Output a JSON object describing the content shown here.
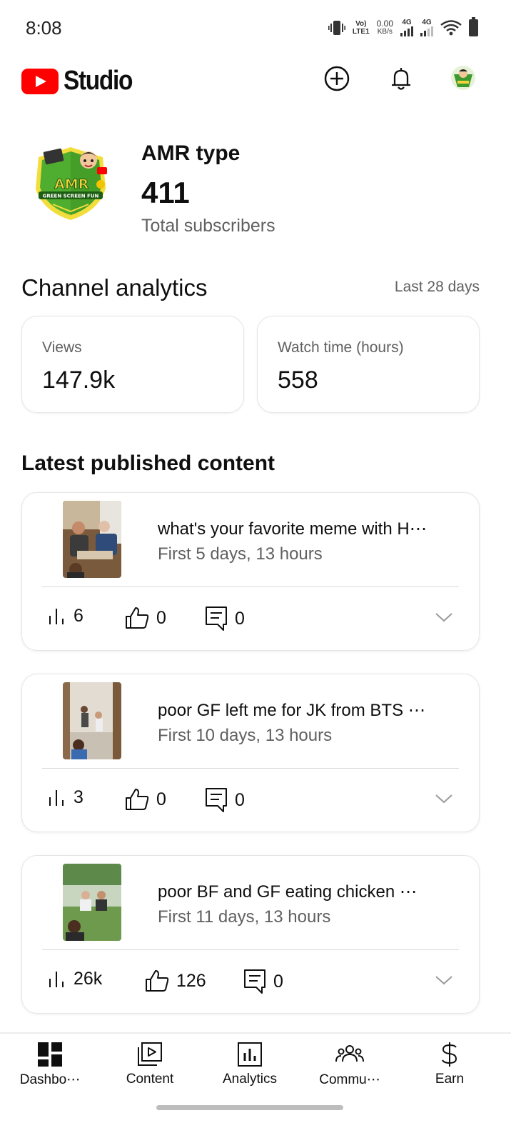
{
  "status_bar": {
    "time": "8:08",
    "volte": "Vo)",
    "lte": "LTE1",
    "speed_value": "0.00",
    "speed_unit": "KB/s",
    "net1": "4G",
    "net2": "4G"
  },
  "header": {
    "brand": "Studio",
    "icons": [
      "youtube-logo-icon",
      "create-plus-icon",
      "notifications-bell-icon",
      "account-avatar"
    ]
  },
  "channel": {
    "name": "AMR type",
    "subscribers": "411",
    "subscribers_label": "Total subscribers"
  },
  "analytics": {
    "title": "Channel analytics",
    "period": "Last 28 days",
    "cards": [
      {
        "label": "Views",
        "value": "147.9k"
      },
      {
        "label": "Watch time (hours)",
        "value": "558"
      }
    ]
  },
  "latest": {
    "title": "Latest published content",
    "items": [
      {
        "title": "what's your favorite meme with H⋯",
        "subtitle": "First 5 days, 13 hours",
        "views": "6",
        "likes": "0",
        "comments": "0"
      },
      {
        "title": "poor GF left me for JK from BTS ⋯",
        "subtitle": "First 10 days, 13 hours",
        "views": "3",
        "likes": "0",
        "comments": "0"
      },
      {
        "title": "poor BF and GF eating chicken ⋯",
        "subtitle": "First 11 days, 13 hours",
        "views": "26k",
        "likes": "126",
        "comments": "0"
      }
    ]
  },
  "bottom_nav": [
    {
      "label": "Dashbo⋯",
      "icon": "dashboard-icon"
    },
    {
      "label": "Content",
      "icon": "content-icon"
    },
    {
      "label": "Analytics",
      "icon": "analytics-icon"
    },
    {
      "label": "Commu⋯",
      "icon": "community-icon"
    },
    {
      "label": "Earn",
      "icon": "earn-dollar-icon"
    }
  ],
  "colors": {
    "brand_red": "#ff0000",
    "secondary_text": "#606060"
  }
}
